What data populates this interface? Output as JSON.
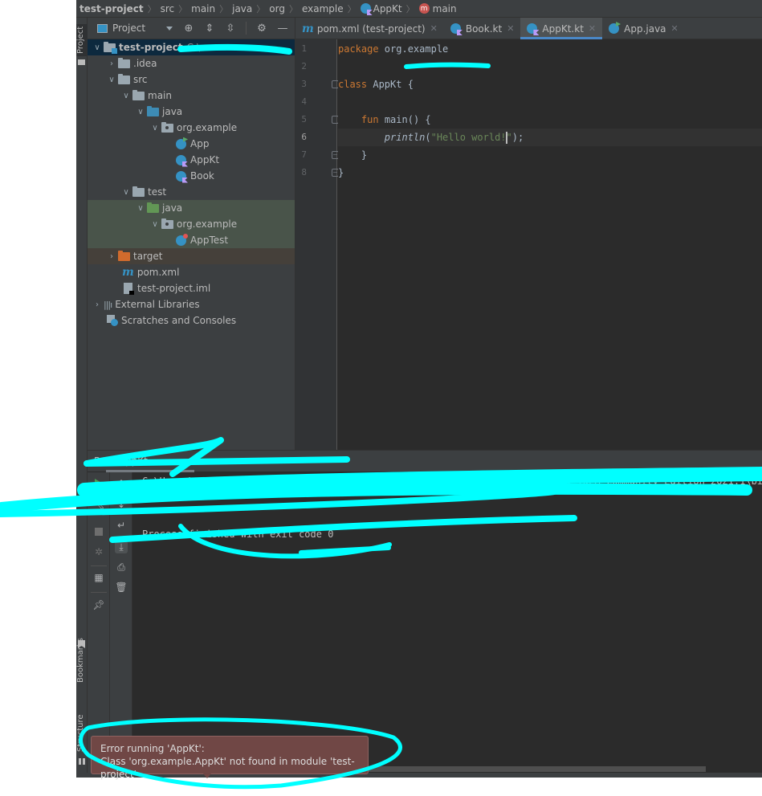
{
  "breadcrumb": [
    {
      "label": "test-project",
      "bold": true
    },
    {
      "label": "src"
    },
    {
      "label": "main"
    },
    {
      "label": "java"
    },
    {
      "label": "org"
    },
    {
      "label": "example"
    },
    {
      "label": "AppKt",
      "icon": "kotlin-class-icon"
    },
    {
      "label": "main",
      "icon": "method-icon",
      "icon_text": "m"
    }
  ],
  "project_panel": {
    "title": "Project",
    "stripe_label": "Project",
    "toolbar": [
      "locate-icon",
      "expand-all-icon",
      "collapse-all-icon",
      "gear-icon",
      "hide-icon"
    ],
    "tree": [
      {
        "label": "test-project",
        "depth": 0,
        "expanded": true,
        "icon": "module-folder",
        "bold": true,
        "selected": true,
        "path_hint": "C:\\"
      },
      {
        "label": ".idea",
        "depth": 1,
        "expanded": false,
        "icon": "folder"
      },
      {
        "label": "src",
        "depth": 1,
        "expanded": true,
        "icon": "folder"
      },
      {
        "label": "main",
        "depth": 2,
        "expanded": true,
        "icon": "folder"
      },
      {
        "label": "java",
        "depth": 3,
        "expanded": true,
        "icon": "source-folder"
      },
      {
        "label": "org.example",
        "depth": 4,
        "expanded": true,
        "icon": "package"
      },
      {
        "label": "App",
        "depth": 5,
        "icon": "java-class"
      },
      {
        "label": "AppKt",
        "depth": 5,
        "icon": "kotlin-class"
      },
      {
        "label": "Book",
        "depth": 5,
        "icon": "kotlin-class"
      },
      {
        "label": "test",
        "depth": 2,
        "expanded": true,
        "icon": "folder"
      },
      {
        "label": "java",
        "depth": 3,
        "expanded": true,
        "icon": "test-folder"
      },
      {
        "label": "org.example",
        "depth": 4,
        "expanded": true,
        "icon": "package"
      },
      {
        "label": "AppTest",
        "depth": 5,
        "icon": "test-class"
      },
      {
        "label": "target",
        "depth": 1,
        "expanded": false,
        "icon": "excluded-folder"
      },
      {
        "label": "pom.xml",
        "depth": 1,
        "icon": "maven-file"
      },
      {
        "label": "test-project.iml",
        "depth": 1,
        "icon": "iml-file"
      },
      {
        "label": "External Libraries",
        "depth": 0,
        "expanded": false,
        "icon": "libraries"
      },
      {
        "label": "Scratches and Consoles",
        "depth": 0,
        "icon": "scratches"
      }
    ]
  },
  "editor": {
    "tabs": [
      {
        "label": "pom.xml (test-project)",
        "icon": "maven-icon",
        "active": false
      },
      {
        "label": "Book.kt",
        "icon": "kotlin-class-icon",
        "active": false
      },
      {
        "label": "AppKt.kt",
        "icon": "kotlin-class-icon",
        "active": true
      },
      {
        "label": "App.java",
        "icon": "java-class-icon",
        "active": false
      }
    ],
    "current_line": 6,
    "lines": [
      {
        "n": "1",
        "text": "package org.example"
      },
      {
        "n": "2",
        "text": ""
      },
      {
        "n": "3",
        "text": "class AppKt {"
      },
      {
        "n": "4",
        "text": ""
      },
      {
        "n": "5",
        "text": "    fun main() {"
      },
      {
        "n": "6",
        "text": "        println(\"Hello world!\");"
      },
      {
        "n": "7",
        "text": "    }"
      },
      {
        "n": "8",
        "text": "}"
      }
    ],
    "tokens": {
      "package_kw": "package",
      "package_name": " org.example",
      "class_kw": "class",
      "class_name": " AppKt {",
      "fun_kw": "fun",
      "fun_sig": " main() {",
      "println": "println",
      "open_paren": "(",
      "string_a": "\"Hello world!",
      "string_b": "\"",
      "close": ");",
      "close_fun": "}",
      "close_class": "}"
    }
  },
  "run_panel": {
    "title": "Run:   AppKt",
    "console_lines": [
      "C:\\Users\\...\\bin\\java.exe \"-javaagent:...\\lib\\idea_rt.jar=...:...\\IntelliJ IDEA Community Edition 2021.1\\bin\" ...",
      "",
      "",
      "Process finished with exit code 0"
    ]
  },
  "side_stripe": {
    "bookmarks_label": "Bookmarks",
    "structure_label": "Structure"
  },
  "error_balloon": {
    "title": "Error running 'AppKt':",
    "message": "Class 'org.example.AppKt' not found in module 'test-project'"
  },
  "colors": {
    "annotation": "#00ffff",
    "error_balloon_bg": "#704745",
    "active_tab_underline": "#4a88c7"
  }
}
